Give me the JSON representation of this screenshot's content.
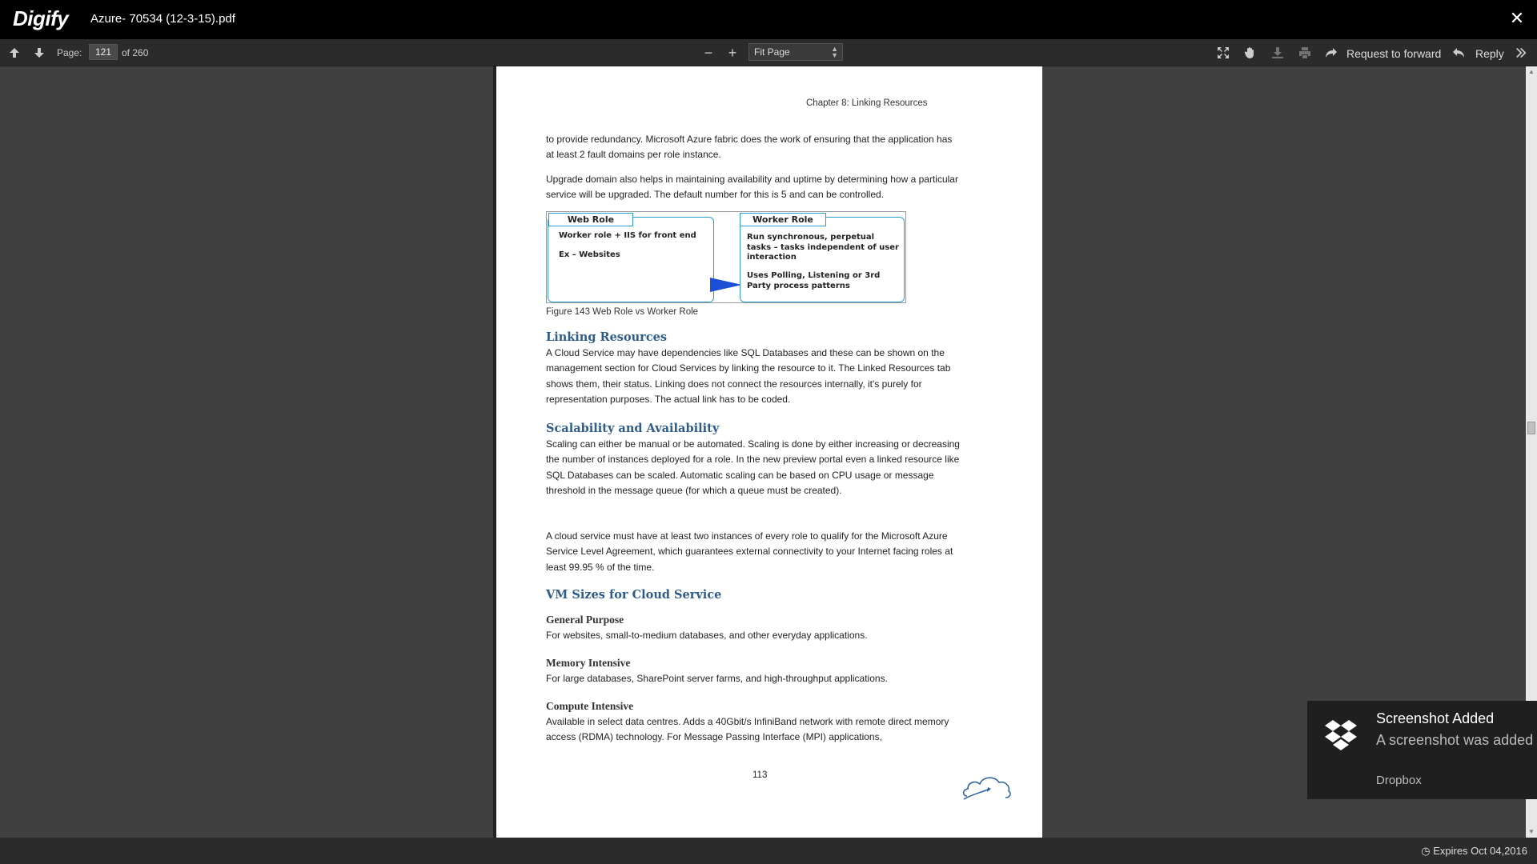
{
  "app": {
    "logo": "Digify",
    "document_title": "Azure- 70534 (12-3-15).pdf",
    "close_icon": "close-icon"
  },
  "toolbar": {
    "page_label": "Page:",
    "current_page": "121",
    "total_pages": "of 260",
    "zoom_out": "−",
    "zoom_in": "+",
    "zoom_value": "Fit Page",
    "request_forward_label": "Request to forward",
    "reply_label": "Reply"
  },
  "document": {
    "running_header": "Chapter 8: Linking Resources",
    "para1": "to provide redundancy. Microsoft Azure fabric does the work of ensuring that the application has at least 2 fault domains per role instance.",
    "para2": "Upgrade domain also helps in maintaining availability and uptime by determining how a particular service will be upgraded.  The default number for this is 5 and can be controlled.",
    "figure": {
      "web_role_label": "Web Role",
      "web_role_line1": "Worker role + IIS for front end",
      "web_role_line2": "Ex – Websites",
      "worker_role_label": "Worker Role",
      "worker_role_text1": "Run synchronous, perpetual tasks – tasks independent of user interaction",
      "worker_role_text2": "Uses Polling, Listening or 3rd Party process patterns"
    },
    "caption": "Figure 143 Web Role vs Worker Role",
    "heading_linking": "Linking Resources",
    "para_linking": "A Cloud Service may have dependencies like SQL Databases and these can be shown on the management section for Cloud Services by linking the resource to it. The Linked Resources tab shows them, their status. Linking does not connect the resources internally, it's purely for representation purposes. The actual link has to be coded.",
    "heading_scalability": "Scalability and Availability",
    "para_scalability": "Scaling can either be manual or be automated. Scaling is done by either increasing or decreasing the number of instances deployed for a role. In the new preview portal even a linked resource like SQL Databases can be scaled. Automatic scaling can be based on CPU usage or message threshold in the message queue (for which a queue must be created).",
    "para_sla": "A cloud service must have at least two instances of every role to qualify for the Microsoft Azure Service Level Agreement, which guarantees external connectivity to your Internet facing roles at least 99.95 % of the time.",
    "heading_vmsizes": "VM Sizes for Cloud Service",
    "sub_general": "General Purpose",
    "para_general": "For websites, small-to-medium databases, and other everyday applications.",
    "sub_memory": "Memory Intensive",
    "para_memory": "For large databases, SharePoint server farms, and high-throughput applications.",
    "sub_compute": "Compute Intensive",
    "para_compute": "Available in select data centres. Adds a 40Gbit/s InfiniBand network with remote direct memory access (RDMA) technology. For Message Passing Interface (MPI) applications,",
    "page_number": "113"
  },
  "status": {
    "expires": "Expires Oct 04,2016"
  },
  "toast": {
    "title": "Screenshot Added",
    "body": "A screenshot was added to Dropbox.",
    "source": "Dropbox"
  }
}
